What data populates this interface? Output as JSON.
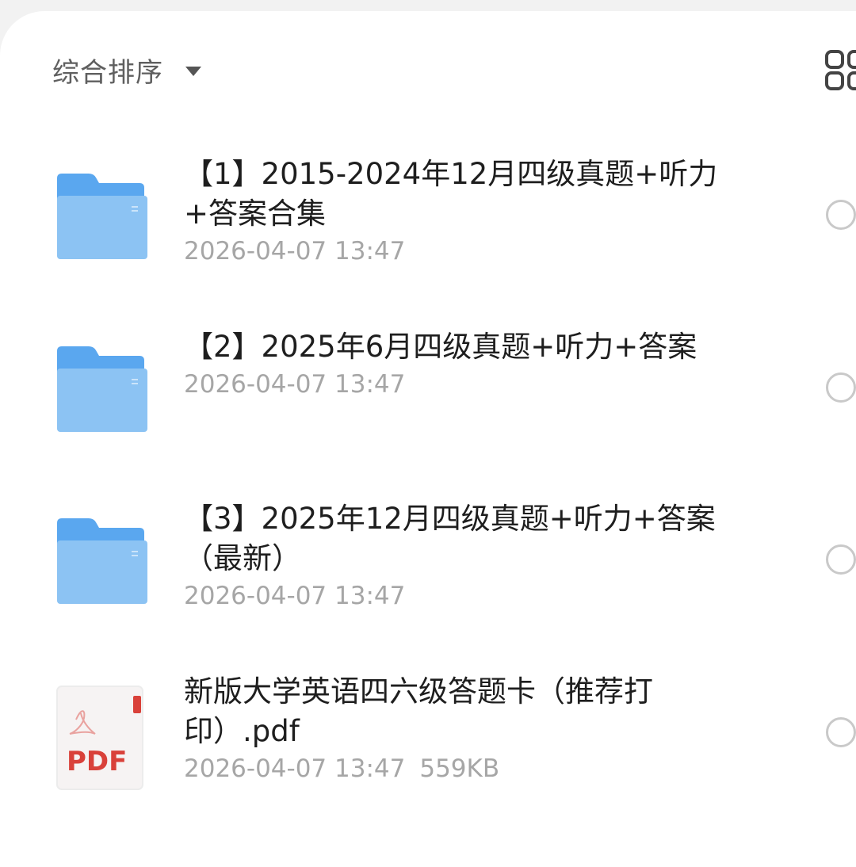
{
  "toolbar": {
    "sort_label": "综合排序",
    "sort_icon": "caret-down-icon",
    "view_toggle_icon": "grid-view-icon"
  },
  "files": [
    {
      "type": "folder",
      "icon": "folder-icon",
      "name": "【1】2015-2024年12月四级真题+听力+答案合集",
      "modified": "2026-04-07 13:47",
      "size": ""
    },
    {
      "type": "folder",
      "icon": "folder-icon",
      "name": "【2】2025年6月四级真题+听力+答案",
      "modified": "2026-04-07 13:47",
      "size": ""
    },
    {
      "type": "folder",
      "icon": "folder-icon",
      "name": "【3】2025年12月四级真题+听力+答案（最新）",
      "modified": "2026-04-07 13:47",
      "size": ""
    },
    {
      "type": "pdf",
      "icon": "pdf-file-icon",
      "icon_label": "PDF",
      "name": "新版大学英语四六级答题卡（推荐打印）.pdf",
      "modified": "2026-04-07 13:47",
      "size": "559KB"
    }
  ],
  "colors": {
    "folder_front": "#8cc3f3",
    "folder_back": "#5aa7ef",
    "pdf_red": "#d9413a",
    "text_primary": "#1e1e1e",
    "text_secondary": "#a6a6a6"
  }
}
